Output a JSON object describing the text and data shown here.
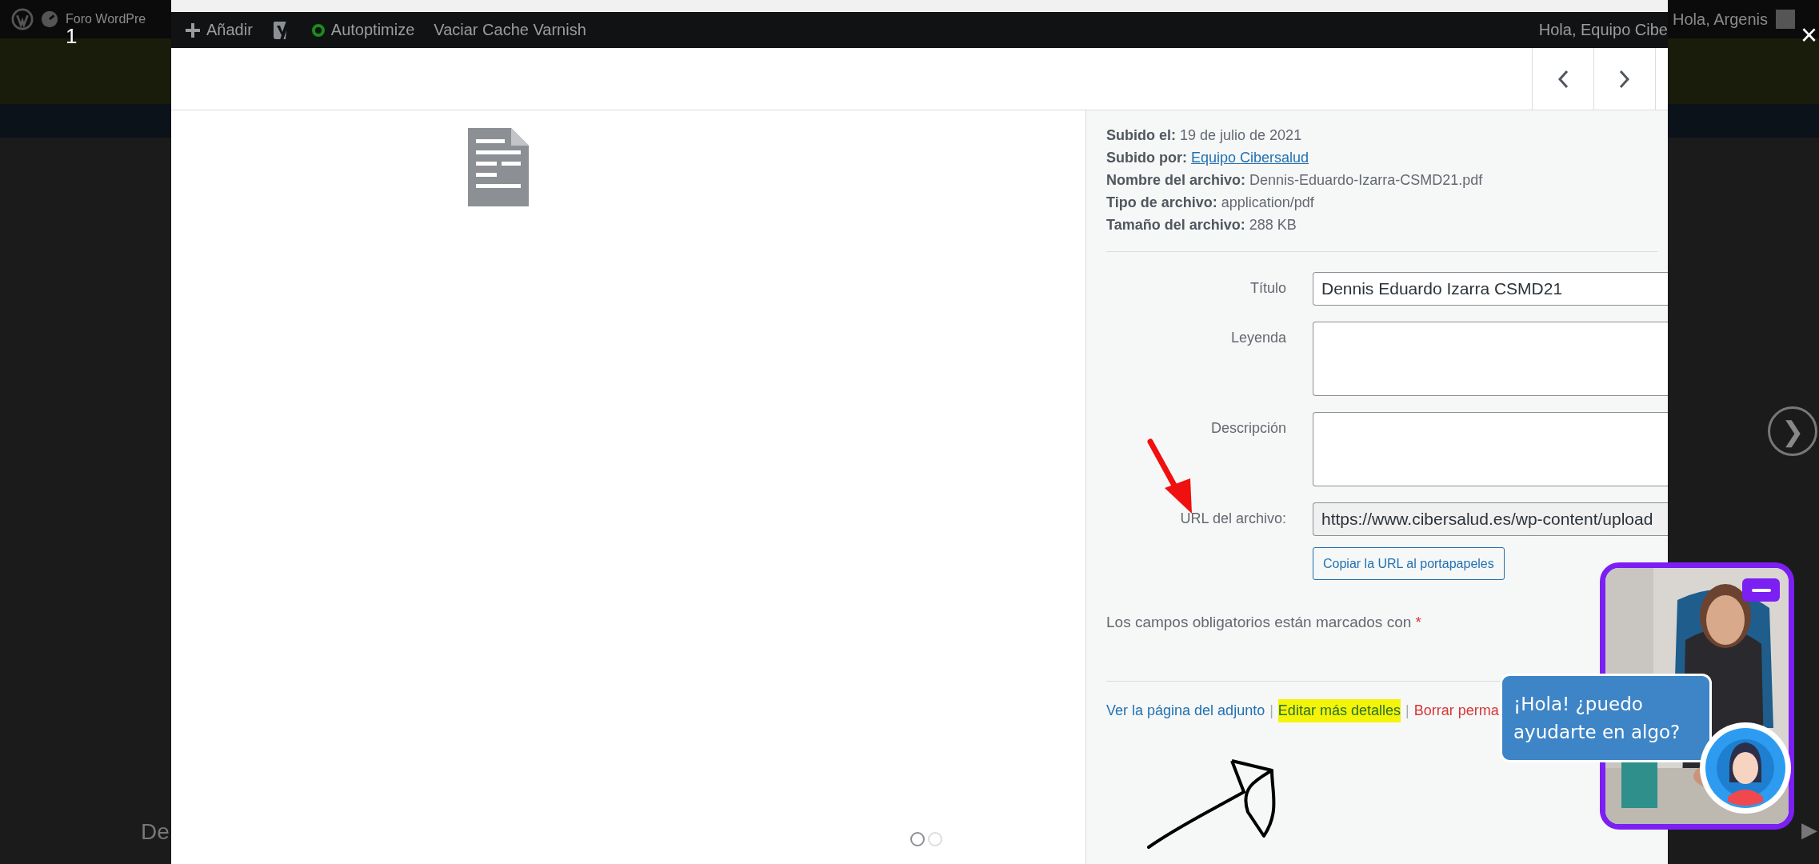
{
  "background_page": {
    "admin_bar": {
      "site_name": "Foro WordPre",
      "greeting": "Hola, Argenis"
    },
    "text_fragment": "De"
  },
  "lightbox": {
    "counter": "1",
    "close": "×",
    "next": "❯",
    "play": "▶"
  },
  "modal": {
    "admin_bar": {
      "items": [
        {
          "kind": "add",
          "label": "Añadir"
        },
        {
          "kind": "yoast"
        },
        {
          "kind": "status",
          "label": "Autoptimize"
        },
        {
          "kind": "plain",
          "label": "Vaciar Cache Varnish"
        }
      ],
      "greeting": "Hola, Equipo Cibe"
    },
    "details": [
      {
        "kind": "text",
        "label": "Subido el:",
        "value": "19 de julio de 2021"
      },
      {
        "kind": "link",
        "label": "Subido por:",
        "value": "Equipo Cibersalud"
      },
      {
        "kind": "text",
        "label": "Nombre del archivo:",
        "value": "Dennis-Eduardo-Izarra-CSMD21.pdf"
      },
      {
        "kind": "text",
        "label": "Tipo de archivo:",
        "value": "application/pdf"
      },
      {
        "kind": "text",
        "label": "Tamaño del archivo:",
        "value": "288 KB"
      }
    ],
    "fields": [
      {
        "kind": "input",
        "label": "Título",
        "value": "Dennis Eduardo Izarra CSMD21"
      },
      {
        "kind": "textarea",
        "label": "Leyenda"
      },
      {
        "kind": "textarea",
        "label": "Descripción"
      },
      {
        "kind": "readonly",
        "label": "URL del archivo:",
        "value": "https://www.cibersalud.es/wp-content/upload"
      }
    ],
    "copy_button": "Copiar la URL al portapapeles",
    "required_note": {
      "text": "Los campos obligatorios están marcados con",
      "mark": "*"
    },
    "actions": [
      {
        "kind": "link",
        "label": "Ver la página del adjunto",
        "highlighted": false
      },
      {
        "kind": "separator",
        "label": "|"
      },
      {
        "kind": "link",
        "label": "Editar más detalles",
        "highlighted": true
      },
      {
        "kind": "separator",
        "label": "|"
      },
      {
        "kind": "danger",
        "label": "Borrar perma",
        "highlighted": false
      }
    ],
    "pager": [
      {
        "selected": true
      },
      {
        "selected": false
      }
    ]
  },
  "chat": {
    "message": "¡Hola! ¿puedo ayudarte en algo?"
  }
}
